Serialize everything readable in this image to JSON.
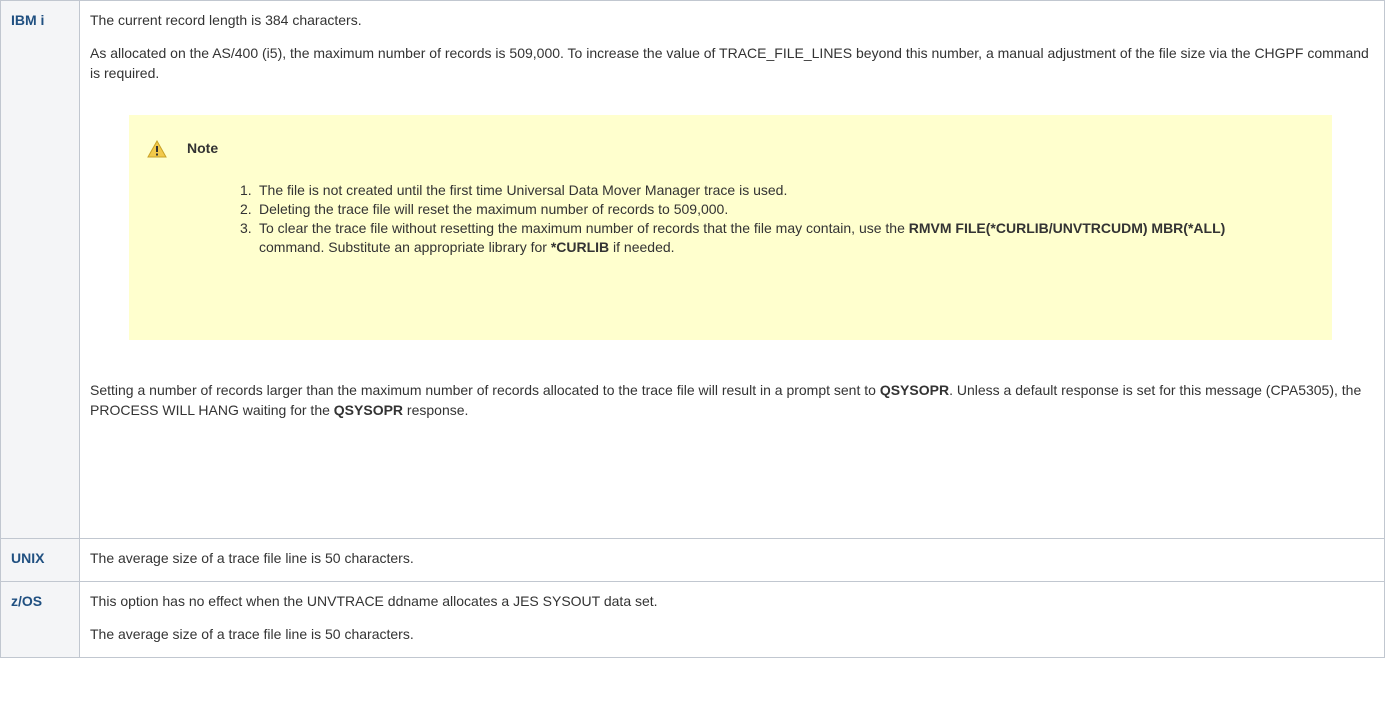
{
  "rows": {
    "ibmi": {
      "platform": "IBM i",
      "p1": "The current record length is 384 characters.",
      "p2": "As allocated on the AS/400 (i5), the maximum number of records is 509,000. To increase the value of TRACE_FILE_LINES beyond this number, a manual adjustment of the file size via the CHGPF command is required.",
      "note": {
        "title": "Note",
        "icon": "warning-icon",
        "items": [
          {
            "num": "1.",
            "text": "The file is not created until the first time Universal Data Mover Manager trace is used."
          },
          {
            "num": "2.",
            "text": "Deleting the trace file will reset the maximum number of records to 509,000."
          },
          {
            "num": "3.",
            "pre": "To clear the trace file without resetting the maximum number of records that the file may contain, use the ",
            "cmd": "RMVM FILE(*CURLIB/UNVTRCUDM) MBR(*ALL)",
            "mid": " command. Substitute an appropriate library for ",
            "lib": "*CURLIB",
            "post": " if needed."
          }
        ]
      },
      "p3": {
        "pre": "Setting a number of records larger than the maximum number of records allocated to the trace file will result in a prompt sent to ",
        "b1": "QSYSOPR",
        "mid": ". Unless a default response is set for this message (CPA5305), the PROCESS WILL HANG waiting for the ",
        "b2": "QSYSOPR",
        "post": " response."
      }
    },
    "unix": {
      "platform": "UNIX",
      "p1": "The average size of a trace file line is 50 characters."
    },
    "zos": {
      "platform": "z/OS",
      "p1": "This option has no effect when the UNVTRACE ddname allocates a JES SYSOUT data set.",
      "p2": "The average size of a trace file line is 50 characters."
    }
  },
  "colors": {
    "platform_text": "#205081",
    "platform_bg": "#f4f5f7",
    "border": "#c1c7d0",
    "note_bg": "#ffffce",
    "warning": "#f2c94c"
  }
}
